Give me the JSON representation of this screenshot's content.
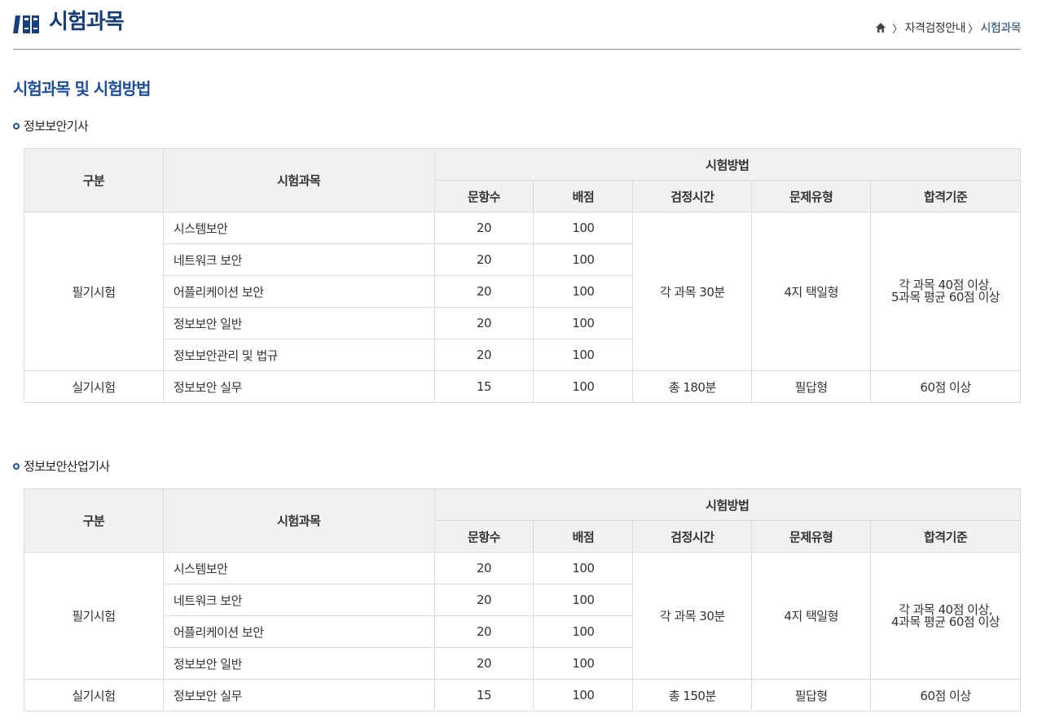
{
  "header": {
    "title": "시험과목",
    "breadcrumb": [
      "자격검정안내",
      "시험과목"
    ]
  },
  "section_title": "시험과목 및 시험방법",
  "tables": [
    {
      "name": "정보보안기사",
      "headers": {
        "category": "구분",
        "subject": "시험과목",
        "method": "시험방법",
        "count": "문항수",
        "score": "배점",
        "time": "검정시간",
        "type": "문제유형",
        "pass": "합격기준"
      },
      "written": {
        "label": "필기시험",
        "rows": [
          {
            "subject": "시스템보안",
            "count": "20",
            "score": "100"
          },
          {
            "subject": "네트워크 보안",
            "count": "20",
            "score": "100"
          },
          {
            "subject": "어플리케이션 보안",
            "count": "20",
            "score": "100"
          },
          {
            "subject": "정보보안 일반",
            "count": "20",
            "score": "100"
          },
          {
            "subject": "정보보안관리 및 법규",
            "count": "20",
            "score": "100"
          }
        ],
        "time": "각 과목 30분",
        "type": "4지 택일형",
        "pass_line1": "각 과목 40점 이상,",
        "pass_line2": "5과목 평균 60점 이상"
      },
      "practical": {
        "label": "실기시험",
        "subject": "정보보안 실무",
        "count": "15",
        "score": "100",
        "time": "총 180분",
        "type": "필답형",
        "pass": "60점 이상"
      }
    },
    {
      "name": "정보보안산업기사",
      "headers": {
        "category": "구분",
        "subject": "시험과목",
        "method": "시험방법",
        "count": "문항수",
        "score": "배점",
        "time": "검정시간",
        "type": "문제유형",
        "pass": "합격기준"
      },
      "written": {
        "label": "필기시험",
        "rows": [
          {
            "subject": "시스템보안",
            "count": "20",
            "score": "100"
          },
          {
            "subject": "네트워크 보안",
            "count": "20",
            "score": "100"
          },
          {
            "subject": "어플리케이션 보안",
            "count": "20",
            "score": "100"
          },
          {
            "subject": "정보보안 일반",
            "count": "20",
            "score": "100"
          }
        ],
        "time": "각 과목 30분",
        "type": "4지 택일형",
        "pass_line1": "각 과목 40점 이상,",
        "pass_line2": "4과목 평균 60점 이상"
      },
      "practical": {
        "label": "실기시험",
        "subject": "정보보안 실무",
        "count": "15",
        "score": "100",
        "time": "총 150분",
        "type": "필답형",
        "pass": "60점 이상"
      }
    }
  ]
}
